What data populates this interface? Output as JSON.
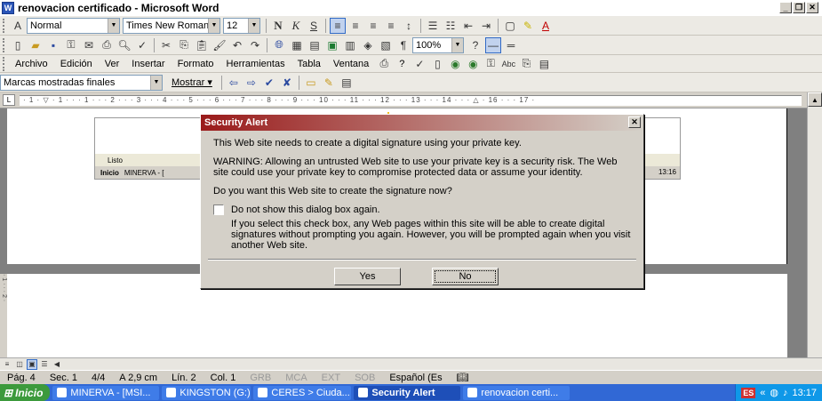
{
  "window": {
    "title": "renovacion certificado - Microsoft Word",
    "app_icon": "W"
  },
  "toolbar1": {
    "style": "Normal",
    "font": "Times New Roman",
    "size": "12",
    "bold": "N",
    "italic": "K",
    "underline": "S"
  },
  "toolbar2": {
    "zoom": "100%"
  },
  "menu": {
    "items": [
      "Archivo",
      "Edición",
      "Ver",
      "Insertar",
      "Formato",
      "Herramientas",
      "Tabla",
      "Ventana",
      "?"
    ]
  },
  "toolbar3": {
    "markup_view": "Marcas mostradas finales",
    "show_label": "Mostrar ▾"
  },
  "ruler": {
    "text": "· 1 · ▽ · 1 · · · 1 · · · 2 · · · 3 · · · 4 · · · 5 · · · 6 · · · 7 · · · 8 · · · 9 · · · 10 · · · 11 · · · 12 · · · 13 · · · 14 · · · △ · 16 · · · 17 ·"
  },
  "embedded": {
    "status": "Listo",
    "start": "Inicio",
    "task": "MINERVA - [",
    "time": "13:16"
  },
  "dialog": {
    "title": "Security Alert",
    "close": "✕",
    "line1": "This Web site needs to create a digital signature using your private key.",
    "warning": "WARNING: Allowing an untrusted Web site to use your private key is a security risk. The Web site could use your private key to compromise protected data or assume your identity.",
    "question": "Do you want this Web site to create the signature now?",
    "checkbox_label": "Do not show this dialog box again.",
    "checkbox_detail": "If you select this check box, any Web pages within this site will be able to create digital signatures without prompting you again. However, you will be prompted again when you visit another Web site.",
    "yes": "Yes",
    "no": "No"
  },
  "statusbar": {
    "page": "Pág. 4",
    "section": "Sec. 1",
    "pages": "4/4",
    "at": "A 2,9 cm",
    "line": "Lín. 2",
    "col": "Col. 1",
    "grb": "GRB",
    "mca": "MCA",
    "ext": "EXT",
    "sob": "SOB",
    "language": "Español (Es"
  },
  "taskbar": {
    "start": "Inicio",
    "tasks": [
      "MINERVA - [MSI...",
      "KINGSTON (G:)",
      "CERES > Ciuda...",
      "Security Alert",
      "renovacion certi..."
    ],
    "lang": "ES",
    "time": "13:17"
  }
}
